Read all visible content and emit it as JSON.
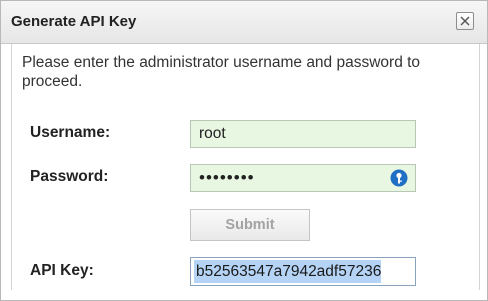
{
  "dialog": {
    "title": "Generate API Key",
    "close_icon": "close-x-icon",
    "instructions": "Please enter the administrator username and password to proceed.",
    "username": {
      "label": "Username:",
      "value": "root"
    },
    "password": {
      "label": "Password:",
      "masked_value": "••••••••",
      "icon": "password-manager-key-icon",
      "icon_color": "#1f6fc4"
    },
    "submit_label": "Submit",
    "api_key": {
      "label": "API Key:",
      "value": "b52563547a7942adf57236"
    }
  },
  "colors": {
    "input_autofill_bg": "#e8f7e2",
    "selection_bg": "#b4d3f5",
    "disabled_text": "#a3a3a3"
  }
}
